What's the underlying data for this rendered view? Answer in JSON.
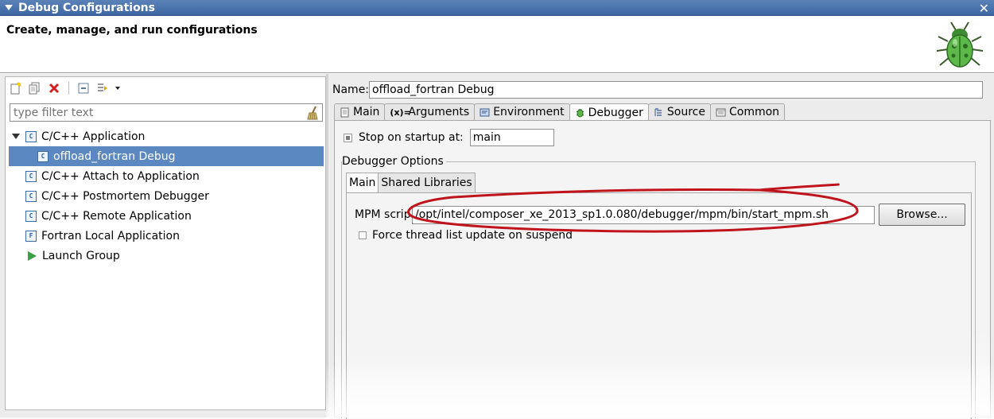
{
  "window": {
    "title": "Debug Configurations",
    "header": "Create, manage, and run configurations"
  },
  "left": {
    "filter_placeholder": "type filter text",
    "tree": [
      {
        "label": "C/C++ Application",
        "icon": "c-app-icon",
        "expanded": true
      },
      {
        "label": "offload_fortran Debug",
        "icon": "c-config-icon",
        "selected": true
      },
      {
        "label": "C/C++ Attach to Application",
        "icon": "c-app-icon"
      },
      {
        "label": "C/C++ Postmortem Debugger",
        "icon": "c-app-icon"
      },
      {
        "label": "C/C++ Remote Application",
        "icon": "c-app-icon"
      },
      {
        "label": "Fortran Local Application",
        "icon": "fortran-app-icon"
      },
      {
        "label": "Launch Group",
        "icon": "launch-group-icon"
      }
    ]
  },
  "right": {
    "name_label": "Name:",
    "name_value": "offload_fortran Debug",
    "tabs": [
      {
        "label": "Main"
      },
      {
        "label": "Arguments"
      },
      {
        "label": "Environment"
      },
      {
        "label": "Debugger",
        "active": true
      },
      {
        "label": "Source"
      },
      {
        "label": "Common"
      }
    ],
    "stop_label": "Stop on startup at:",
    "stop_value": "main",
    "stop_checked": true,
    "group_title": "Debugger Options",
    "subtabs": [
      {
        "label": "Main",
        "active": true
      },
      {
        "label": "Shared Libraries"
      }
    ],
    "mpm_label": "MPM script",
    "mpm_value": "/opt/intel/composer_xe_2013_sp1.0.080/debugger/mpm/bin/start_mpm.sh",
    "browse_label": "Browse...",
    "force_label": "Force thread list update on suspend",
    "force_checked": false
  },
  "colors": {
    "selection": "#5b88c0",
    "titlebar": "#4a74ad",
    "annotation": "#c0141c"
  }
}
